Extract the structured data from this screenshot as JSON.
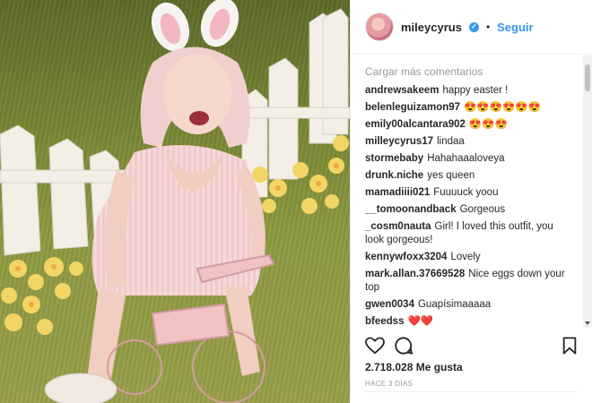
{
  "post": {
    "username": "mileycyrus",
    "follow_label": "Seguir",
    "dot": "•",
    "verified_mark": "✓"
  },
  "comments_section": {
    "load_more": "Cargar más comentarios",
    "items": [
      {
        "user": "andrewsakeem",
        "text": "happy easter !"
      },
      {
        "user": "belenleguizamon97",
        "text": "😍😍😍😍😍😍"
      },
      {
        "user": "emily00alcantara902",
        "text": "😍😍😍"
      },
      {
        "user": "milleycyrus17",
        "text": "lindaa"
      },
      {
        "user": "stormebaby",
        "text": "Hahahaaaloveya"
      },
      {
        "user": "drunk.niche",
        "text": "yes queen"
      },
      {
        "user": "mamadiiii021",
        "text": "Fuuuuck yoou"
      },
      {
        "user": "__tomoonandback",
        "text": "Gorgeous"
      },
      {
        "user": "_cosm0nauta",
        "text": "Girl! I loved this outfit, you look gorgeous!"
      },
      {
        "user": "kennywfoxx3204",
        "text": "Lovely"
      },
      {
        "user": "mark.allan.37669528",
        "text": "Nice eggs down your top"
      },
      {
        "user": "gwen0034",
        "text": "Guapísimaaaaa"
      },
      {
        "user": "bfeedss",
        "text": "❤️❤️"
      }
    ]
  },
  "footer": {
    "likes": "2.718.028 Me gusta",
    "time_ago": "HACE 3 DÍAS"
  },
  "icons": {
    "like": "heart-icon",
    "comment": "comment-icon",
    "save": "bookmark-icon"
  },
  "colors": {
    "link_blue": "#3897f0",
    "text": "#262626",
    "muted": "#999999"
  }
}
